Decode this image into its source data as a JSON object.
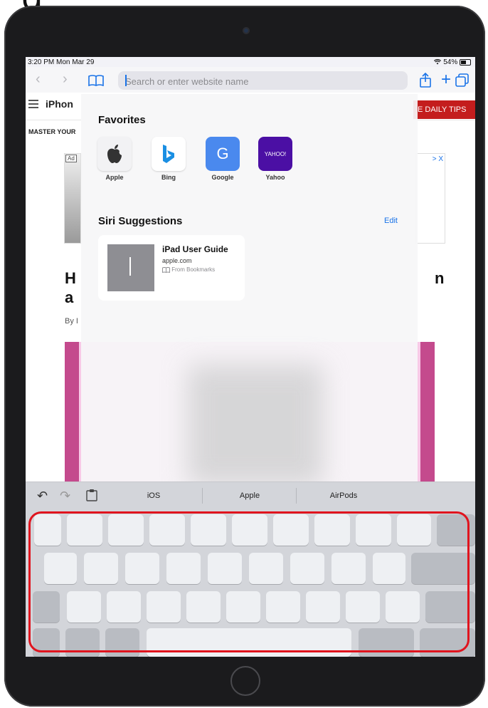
{
  "page_heading_fragment": "g",
  "status_bar": {
    "time": "3:20 PM  Mon Mar 29",
    "wifi_icon": "wifi-icon",
    "battery": "54%"
  },
  "toolbar": {
    "search_placeholder": "Search or enter website name"
  },
  "website": {
    "logo": "iPhon",
    "daily_tips": "E DAILY TIPS",
    "banner_text": "MASTER YOUR",
    "ad_tag": "Ad",
    "ad_close": "> X",
    "headline_left_1": "H",
    "headline_left_2": "a",
    "headline_right": "n",
    "byline": "By I"
  },
  "favorites": {
    "title": "Favorites",
    "items": [
      {
        "label": "Apple",
        "tile_color": "#f2f2f4"
      },
      {
        "label": "Bing",
        "tile_color": "#ffffff"
      },
      {
        "label": "Google",
        "tile_color": "#4a89ee"
      },
      {
        "label": "Yahoo",
        "tile_color": "#4b0fa4",
        "tile_text": "YAHOO!"
      }
    ]
  },
  "siri": {
    "title": "Siri Suggestions",
    "edit": "Edit",
    "card": {
      "title": "iPad User Guide",
      "domain": "apple.com",
      "source": "From Bookmarks"
    }
  },
  "shortcut_bar": {
    "suggestions": [
      "iOS",
      "Apple",
      "AirPods"
    ]
  },
  "colors": {
    "accent": "#1a73e8",
    "highlight": "#e0141e",
    "tips_button": "#c41d1d",
    "pink_block": "#f8c9e7"
  }
}
